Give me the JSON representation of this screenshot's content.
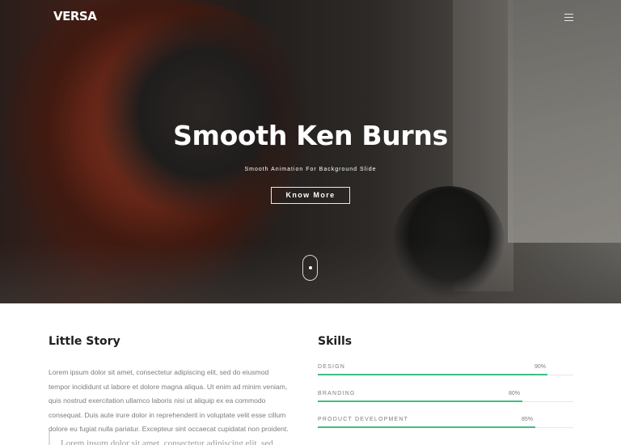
{
  "header": {
    "logo": "VERSA",
    "menu_icon": "hamburger-menu-icon"
  },
  "hero": {
    "title": "Smooth Ken Burns",
    "subtitle": "Smooth Animation For Background Slide",
    "button_label": "Know More",
    "scroll_icon": "mouse-scroll-icon"
  },
  "story": {
    "heading": "Little Story",
    "body": "Lorem ipsum dolor sit amet, consectetur adipiscing elit, sed do eiusmod tempor incididunt ut labore et dolore magna aliqua. Ut enim ad minim veniam, quis nostrud exercitation ullamco laboris nisi ut aliquip ex ea commodo consequat. Duis aute irure dolor in reprehenderit in voluptate velit esse cillum dolore eu fugiat nulla pariatur. Excepteur sint occaecat cupidatat non proident.",
    "quote": "Lorem ipsum dolor sit amet, consectetur adipiscing elit, sed"
  },
  "skills": {
    "heading": "Skills",
    "accent_color": "#3fbf7f",
    "items": [
      {
        "name": "DESIGN",
        "percent_label": "90%",
        "level": 0.9
      },
      {
        "name": "BRANDING",
        "percent_label": "80%",
        "level": 0.8
      },
      {
        "name": "PRODUCT DEVELOPMENT",
        "percent_label": "85%",
        "level": 0.85
      }
    ]
  }
}
